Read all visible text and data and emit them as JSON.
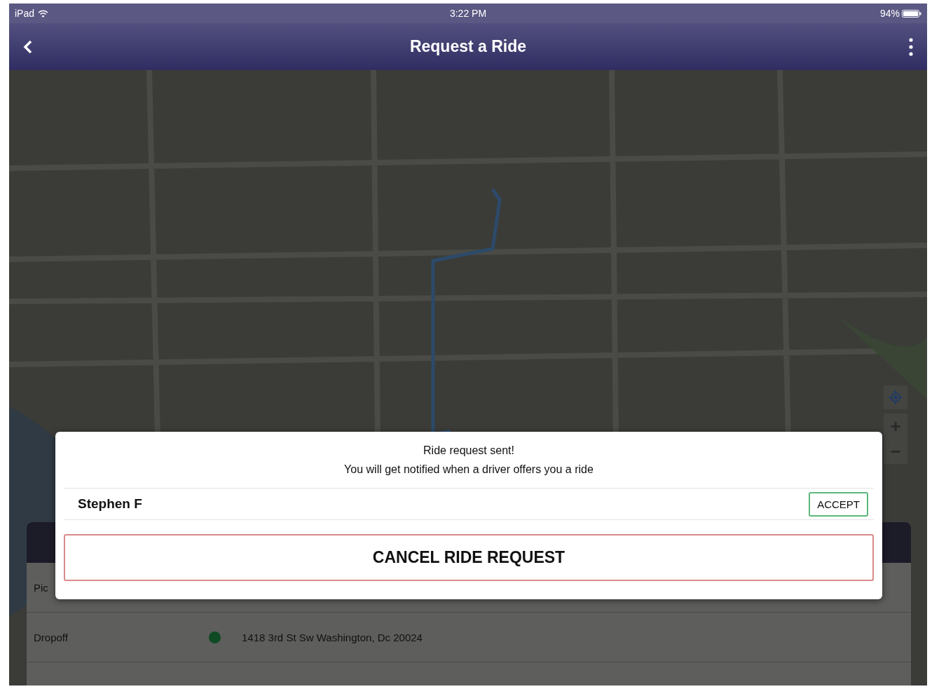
{
  "status_bar": {
    "device": "iPad",
    "time": "3:22 PM",
    "battery": "94%"
  },
  "nav_bar": {
    "title": "Request a Ride"
  },
  "map": {
    "zoom_in": "+",
    "zoom_out": "−"
  },
  "trip_panel": {
    "pickup_label": "Pic",
    "dropoff_label": "Dropoff",
    "dropoff_address": "1418 3rd St Sw Washington, Dc 20024"
  },
  "dialog": {
    "title": "Ride request sent!",
    "message": "You will get notified when a driver offers you a ride",
    "offers": [
      {
        "driver": "Stephen F",
        "action": "ACCEPT"
      }
    ],
    "cancel_button": "CANCEL RIDE REQUEST"
  }
}
